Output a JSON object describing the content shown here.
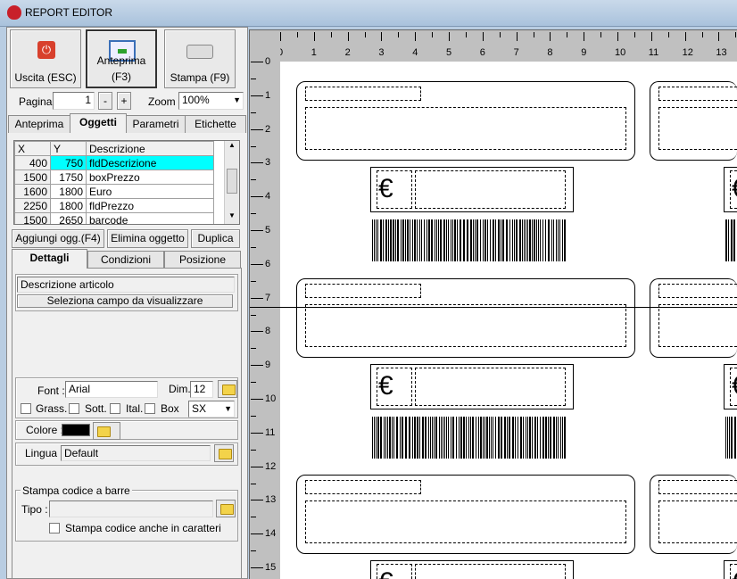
{
  "window": {
    "title": "REPORT EDITOR"
  },
  "toolbar": {
    "exit": "Uscita (ESC)",
    "preview": "Anteprima (F3)",
    "print": "Stampa (F9)"
  },
  "paging": {
    "page_label": "Pagina",
    "page_value": "1",
    "minus": "-",
    "plus": "+",
    "zoom_label": "Zoom",
    "zoom_value": "100%"
  },
  "tabs": [
    "Anteprima",
    "Oggetti",
    "Parametri",
    "Etichette"
  ],
  "objects": {
    "columns": [
      "X",
      "Y",
      "Descrizione"
    ],
    "rows": [
      [
        "400",
        "750",
        "fldDescrizione"
      ],
      [
        "1500",
        "1750",
        "boxPrezzo"
      ],
      [
        "1600",
        "1800",
        "Euro"
      ],
      [
        "2250",
        "1800",
        "fldPrezzo"
      ],
      [
        "1500",
        "2650",
        "barcode"
      ]
    ],
    "selected": 0
  },
  "object_buttons": {
    "add": "Aggiungi ogg.(F4)",
    "delete": "Elimina oggetto",
    "duplicate": "Duplica"
  },
  "subtabs": [
    "Dettagli",
    "Condizioni",
    "Posizione"
  ],
  "details": {
    "field_value": "Descrizione articolo",
    "select_field": "Seleziona campo da visualizzare",
    "font_label": "Font :",
    "font_value": "Arial",
    "dim_label": "Dim.",
    "dim_value": "12",
    "bold": "Grass.",
    "underline": "Sott.",
    "italic": "Ital.",
    "box": "Box",
    "align_value": "SX",
    "color_label": "Colore :",
    "color_value": "#000000",
    "lang_label": "Lingua :",
    "lang_value": "Default",
    "barcode_group": "Stampa codice a barre",
    "type_label": "Tipo :",
    "type_value": "",
    "print_chars": "Stampa codice anche in caratteri"
  },
  "ruler": {
    "h": [
      "0",
      "1",
      "2",
      "3",
      "4",
      "5",
      "6",
      "7",
      "8",
      "9",
      "10",
      "11",
      "12",
      "13"
    ],
    "v": [
      "0",
      "1",
      "2",
      "3",
      "4",
      "5",
      "6",
      "7",
      "8",
      "9",
      "10",
      "11",
      "12",
      "13",
      "14",
      "15"
    ]
  },
  "label": {
    "euro": "€"
  },
  "colors": {
    "selection": "#00ffff",
    "ruler": "#c0c0c0"
  }
}
